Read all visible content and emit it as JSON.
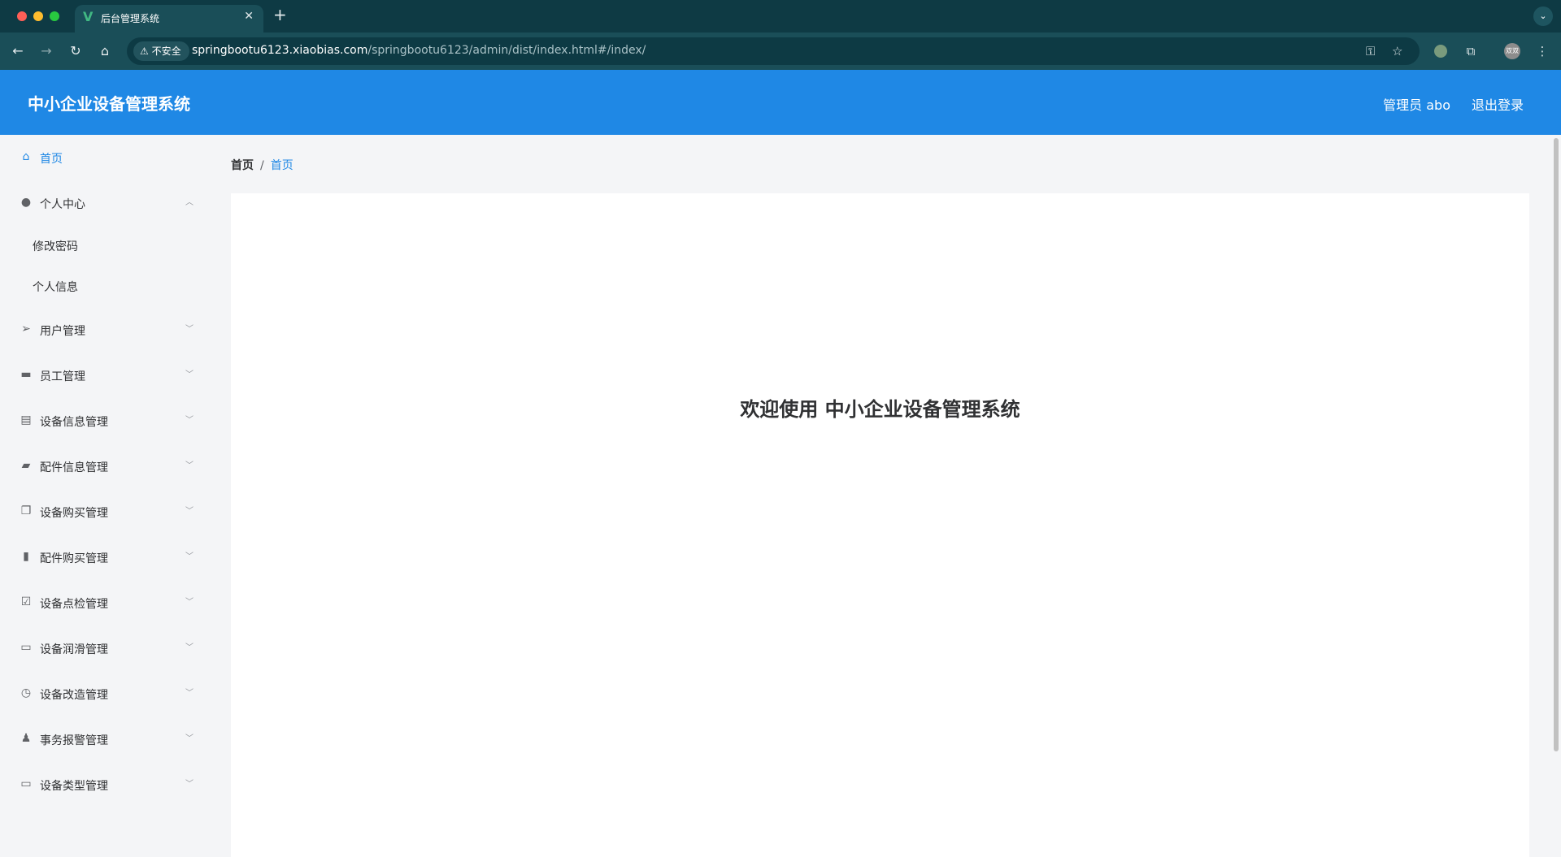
{
  "browser": {
    "tab_title": "后台管理系统",
    "tab_icon": "vue-logo-icon",
    "insecure_label": "不安全",
    "url_host": "springbootu6123.xiaobias.com",
    "url_path": "/springbootu6123/admin/dist/index.html#/index/",
    "profile_label": "双双"
  },
  "header": {
    "title": "中小企业设备管理系统",
    "user_label": "管理员 abo",
    "logout_label": "退出登录"
  },
  "sidebar": {
    "items": [
      {
        "label": "首页",
        "icon": "home-icon",
        "active": true
      },
      {
        "label": "个人中心",
        "icon": "user-icon",
        "expanded": true
      },
      {
        "label": "修改密码"
      },
      {
        "label": "个人信息"
      },
      {
        "label": "用户管理",
        "icon": "send-icon"
      },
      {
        "label": "员工管理",
        "icon": "monitor-icon"
      },
      {
        "label": "设备信息管理",
        "icon": "clipboard-icon"
      },
      {
        "label": "配件信息管理",
        "icon": "wallet-icon"
      },
      {
        "label": "设备购买管理",
        "icon": "copy-icon"
      },
      {
        "label": "配件购买管理",
        "icon": "bar-chart-icon"
      },
      {
        "label": "设备点检管理",
        "icon": "checklist-icon"
      },
      {
        "label": "设备润滑管理",
        "icon": "chat-icon"
      },
      {
        "label": "设备改造管理",
        "icon": "compass-icon"
      },
      {
        "label": "事务报警管理",
        "icon": "person-icon"
      },
      {
        "label": "设备类型管理",
        "icon": "postcard-icon"
      }
    ]
  },
  "breadcrumb": {
    "root": "首页",
    "separator": "/",
    "current": "首页"
  },
  "main": {
    "welcome_text": "欢迎使用 中小企业设备管理系统"
  },
  "colors": {
    "primary": "#1f88e5",
    "sidebar_bg": "#f4f5f7",
    "browser_frame": "#0e3a44"
  }
}
